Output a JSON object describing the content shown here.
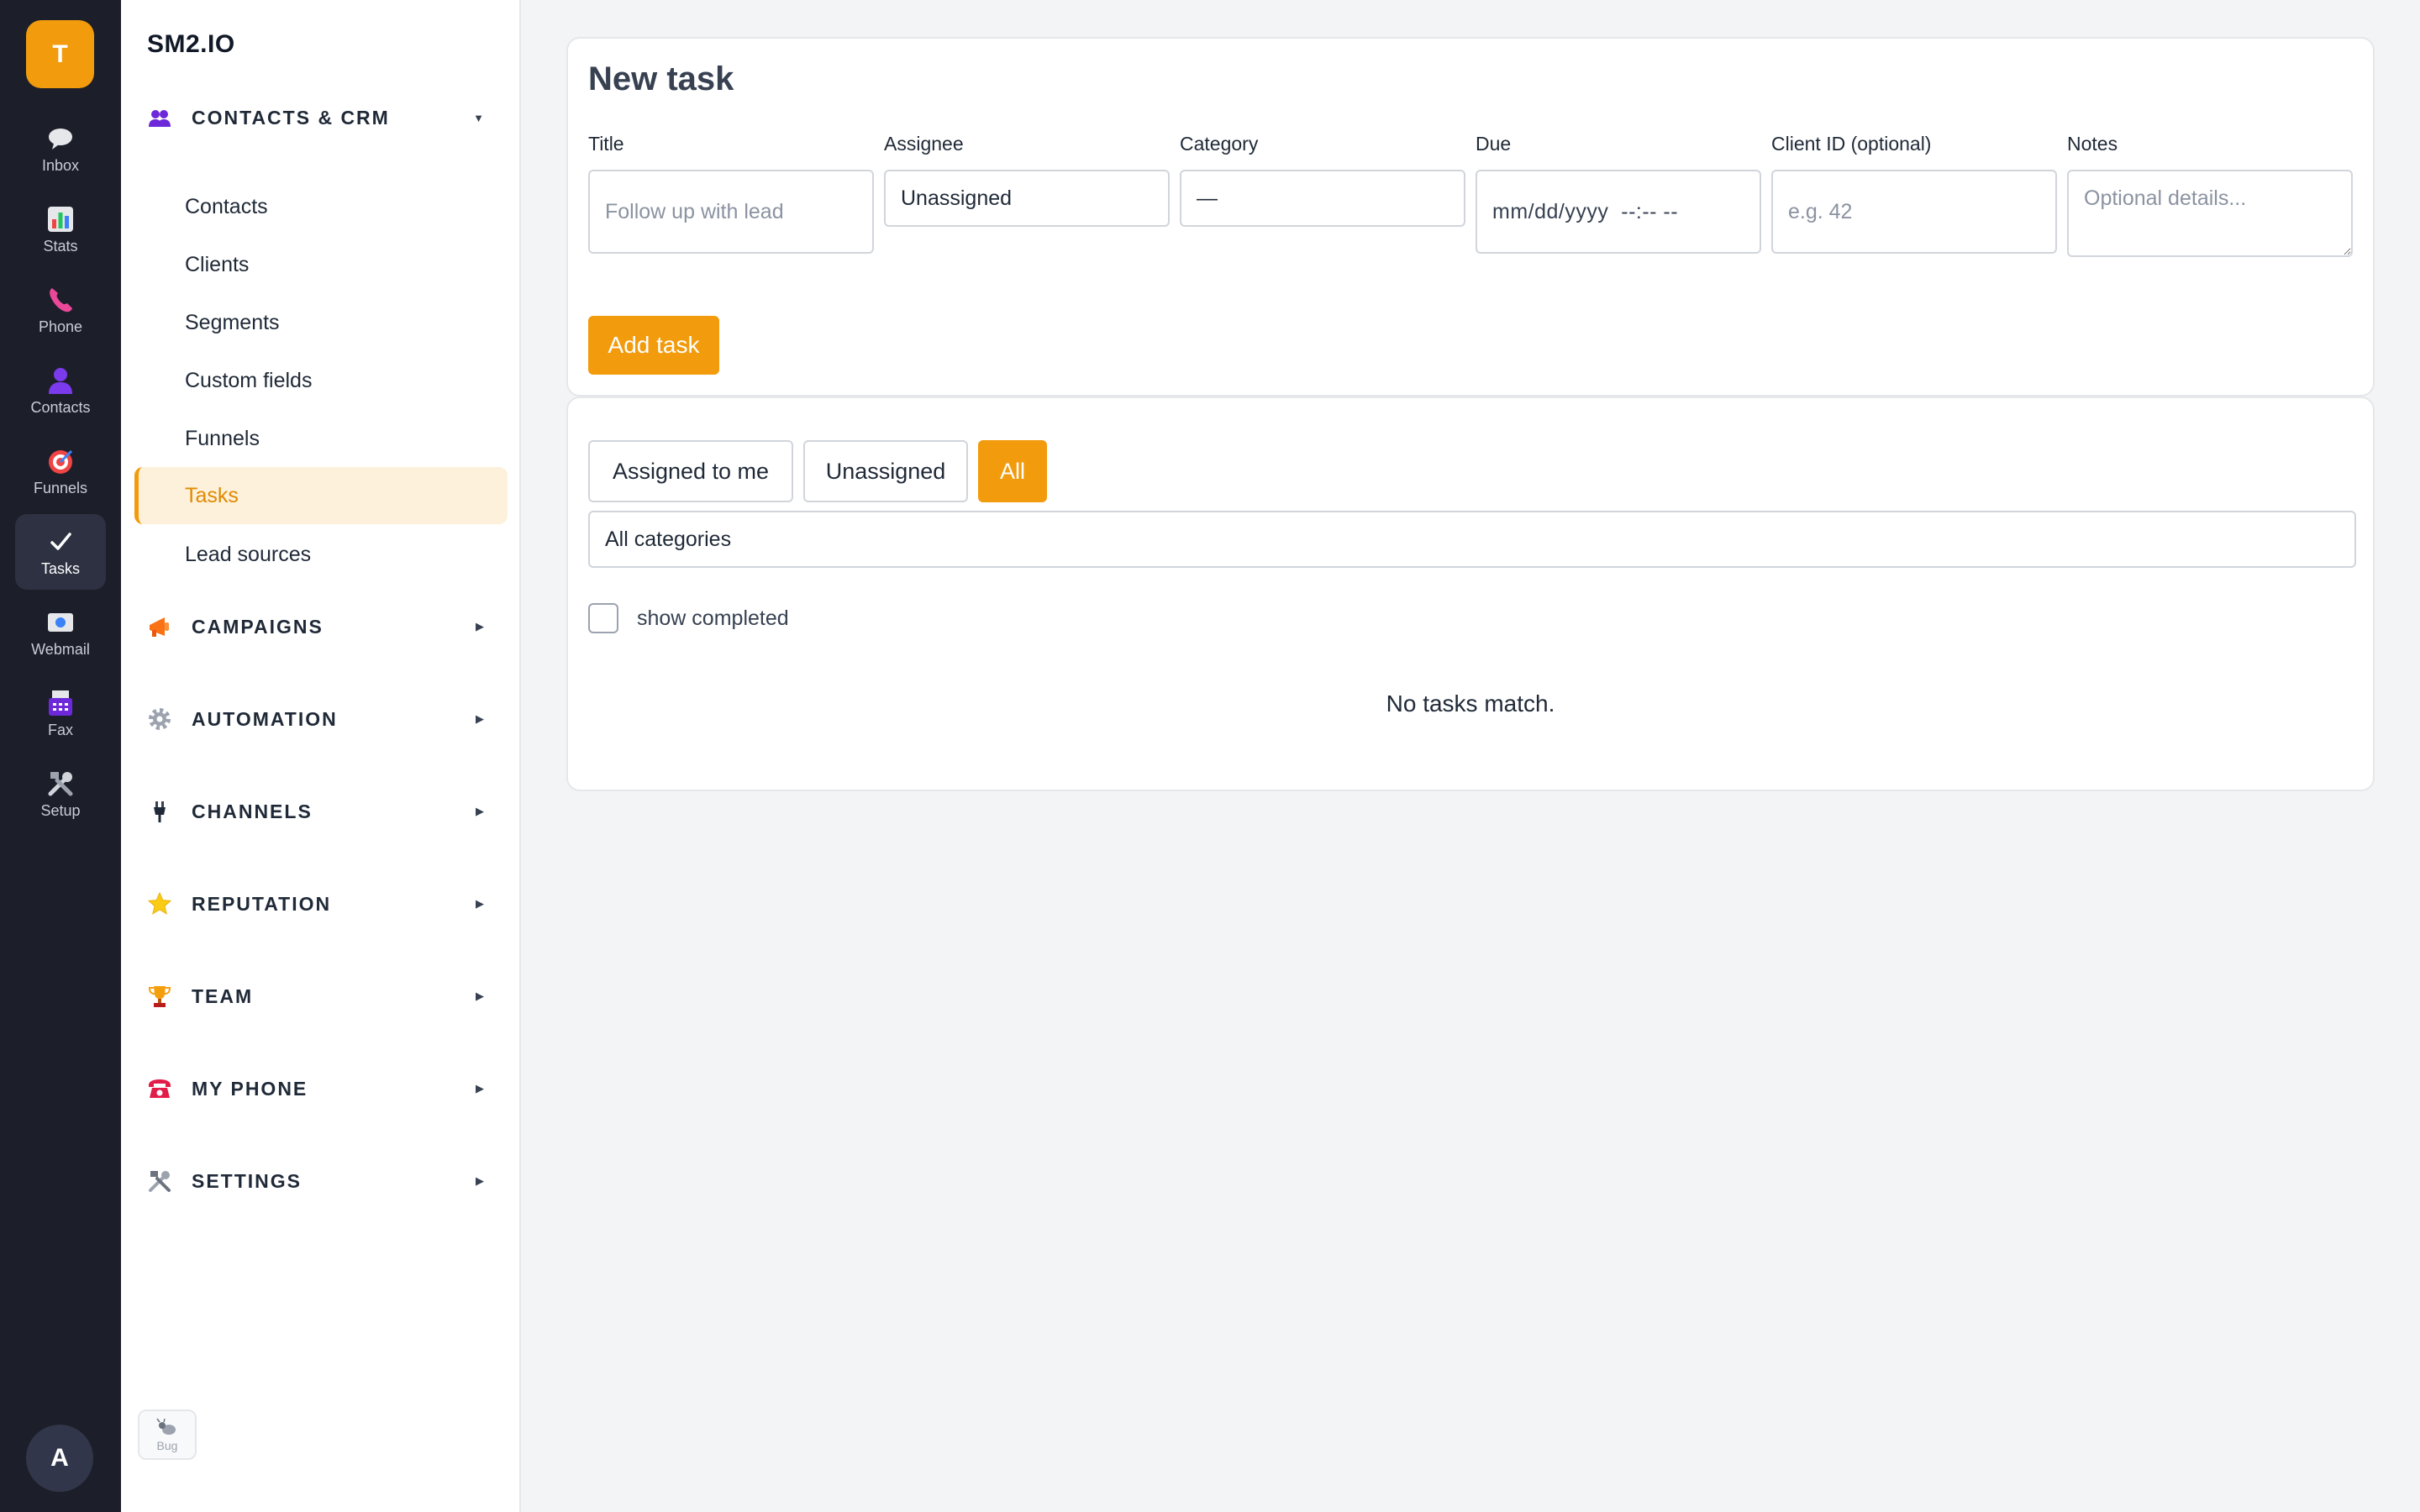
{
  "rail": {
    "badge": "T",
    "items": [
      {
        "label": "Inbox",
        "icon": "speech-bubble-icon"
      },
      {
        "label": "Stats",
        "icon": "bar-chart-icon"
      },
      {
        "label": "Phone",
        "icon": "phone-icon"
      },
      {
        "label": "Contacts",
        "icon": "person-icon"
      },
      {
        "label": "Funnels",
        "icon": "target-icon"
      },
      {
        "label": "Tasks",
        "icon": "checkmark-icon"
      },
      {
        "label": "Webmail",
        "icon": "mail-icon"
      },
      {
        "label": "Fax",
        "icon": "fax-icon"
      },
      {
        "label": "Setup",
        "icon": "tools-icon"
      }
    ],
    "active": "Tasks",
    "avatar": "A"
  },
  "sidebar": {
    "logo": "SM2.IO",
    "sections": [
      {
        "label": "CONTACTS & CRM",
        "icon": "people-icon",
        "expanded": true
      },
      {
        "label": "CAMPAIGNS",
        "icon": "megaphone-icon"
      },
      {
        "label": "AUTOMATION",
        "icon": "gear-icon"
      },
      {
        "label": "CHANNELS",
        "icon": "plug-icon"
      },
      {
        "label": "REPUTATION",
        "icon": "star-icon"
      },
      {
        "label": "TEAM",
        "icon": "trophy-icon"
      },
      {
        "label": "MY PHONE",
        "icon": "telephone-icon"
      },
      {
        "label": "SETTINGS",
        "icon": "tools-icon"
      }
    ],
    "crm_items": [
      "Contacts",
      "Clients",
      "Segments",
      "Custom fields",
      "Funnels",
      "Tasks",
      "Lead sources"
    ],
    "active_item": "Tasks",
    "bug_label": "Bug"
  },
  "new_task": {
    "title": "New task",
    "fields": {
      "title": {
        "label": "Title",
        "placeholder": "Follow up with lead"
      },
      "assignee": {
        "label": "Assignee",
        "value": "Unassigned"
      },
      "category": {
        "label": "Category",
        "value": "—"
      },
      "due": {
        "label": "Due",
        "value": "mm/dd/yyyy  --:-- --"
      },
      "client_id": {
        "label": "Client ID (optional)",
        "placeholder": "e.g. 42"
      },
      "notes": {
        "label": "Notes",
        "placeholder": "Optional details..."
      }
    },
    "submit": "Add task"
  },
  "task_list": {
    "filters": [
      "Assigned to me",
      "Unassigned",
      "All"
    ],
    "active_filter": "All",
    "category_filter": "All categories",
    "show_completed_label": "show completed",
    "show_completed": false,
    "empty_message": "No tasks match."
  },
  "colors": {
    "accent": "#f29b0c",
    "rail_bg": "#1c1f2a",
    "active_nav_bg": "#fdf1dc"
  }
}
